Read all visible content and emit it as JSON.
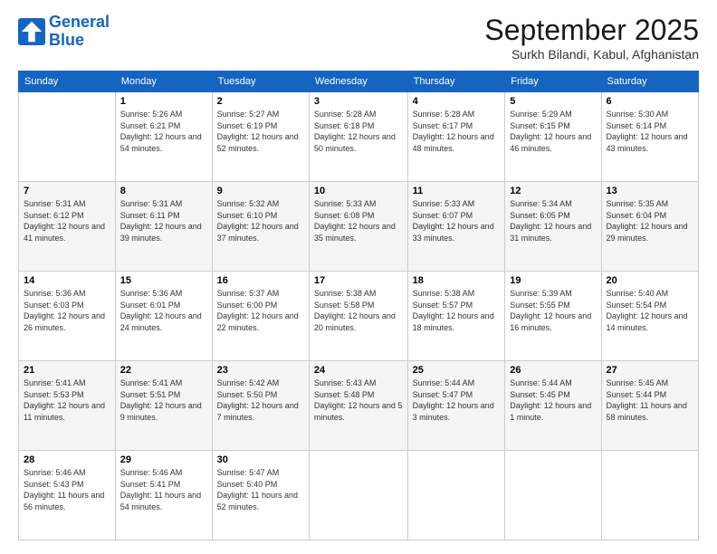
{
  "logo": {
    "line1": "General",
    "line2": "Blue"
  },
  "header": {
    "month": "September 2025",
    "location": "Surkh Bilandi, Kabul, Afghanistan"
  },
  "weekdays": [
    "Sunday",
    "Monday",
    "Tuesday",
    "Wednesday",
    "Thursday",
    "Friday",
    "Saturday"
  ],
  "weeks": [
    [
      {
        "day": "",
        "info": ""
      },
      {
        "day": "1",
        "info": "Sunrise: 5:26 AM\nSunset: 6:21 PM\nDaylight: 12 hours\nand 54 minutes."
      },
      {
        "day": "2",
        "info": "Sunrise: 5:27 AM\nSunset: 6:19 PM\nDaylight: 12 hours\nand 52 minutes."
      },
      {
        "day": "3",
        "info": "Sunrise: 5:28 AM\nSunset: 6:18 PM\nDaylight: 12 hours\nand 50 minutes."
      },
      {
        "day": "4",
        "info": "Sunrise: 5:28 AM\nSunset: 6:17 PM\nDaylight: 12 hours\nand 48 minutes."
      },
      {
        "day": "5",
        "info": "Sunrise: 5:29 AM\nSunset: 6:15 PM\nDaylight: 12 hours\nand 46 minutes."
      },
      {
        "day": "6",
        "info": "Sunrise: 5:30 AM\nSunset: 6:14 PM\nDaylight: 12 hours\nand 43 minutes."
      }
    ],
    [
      {
        "day": "7",
        "info": "Sunrise: 5:31 AM\nSunset: 6:12 PM\nDaylight: 12 hours\nand 41 minutes."
      },
      {
        "day": "8",
        "info": "Sunrise: 5:31 AM\nSunset: 6:11 PM\nDaylight: 12 hours\nand 39 minutes."
      },
      {
        "day": "9",
        "info": "Sunrise: 5:32 AM\nSunset: 6:10 PM\nDaylight: 12 hours\nand 37 minutes."
      },
      {
        "day": "10",
        "info": "Sunrise: 5:33 AM\nSunset: 6:08 PM\nDaylight: 12 hours\nand 35 minutes."
      },
      {
        "day": "11",
        "info": "Sunrise: 5:33 AM\nSunset: 6:07 PM\nDaylight: 12 hours\nand 33 minutes."
      },
      {
        "day": "12",
        "info": "Sunrise: 5:34 AM\nSunset: 6:05 PM\nDaylight: 12 hours\nand 31 minutes."
      },
      {
        "day": "13",
        "info": "Sunrise: 5:35 AM\nSunset: 6:04 PM\nDaylight: 12 hours\nand 29 minutes."
      }
    ],
    [
      {
        "day": "14",
        "info": "Sunrise: 5:36 AM\nSunset: 6:03 PM\nDaylight: 12 hours\nand 26 minutes."
      },
      {
        "day": "15",
        "info": "Sunrise: 5:36 AM\nSunset: 6:01 PM\nDaylight: 12 hours\nand 24 minutes."
      },
      {
        "day": "16",
        "info": "Sunrise: 5:37 AM\nSunset: 6:00 PM\nDaylight: 12 hours\nand 22 minutes."
      },
      {
        "day": "17",
        "info": "Sunrise: 5:38 AM\nSunset: 5:58 PM\nDaylight: 12 hours\nand 20 minutes."
      },
      {
        "day": "18",
        "info": "Sunrise: 5:38 AM\nSunset: 5:57 PM\nDaylight: 12 hours\nand 18 minutes."
      },
      {
        "day": "19",
        "info": "Sunrise: 5:39 AM\nSunset: 5:55 PM\nDaylight: 12 hours\nand 16 minutes."
      },
      {
        "day": "20",
        "info": "Sunrise: 5:40 AM\nSunset: 5:54 PM\nDaylight: 12 hours\nand 14 minutes."
      }
    ],
    [
      {
        "day": "21",
        "info": "Sunrise: 5:41 AM\nSunset: 5:53 PM\nDaylight: 12 hours\nand 11 minutes."
      },
      {
        "day": "22",
        "info": "Sunrise: 5:41 AM\nSunset: 5:51 PM\nDaylight: 12 hours\nand 9 minutes."
      },
      {
        "day": "23",
        "info": "Sunrise: 5:42 AM\nSunset: 5:50 PM\nDaylight: 12 hours\nand 7 minutes."
      },
      {
        "day": "24",
        "info": "Sunrise: 5:43 AM\nSunset: 5:48 PM\nDaylight: 12 hours\nand 5 minutes."
      },
      {
        "day": "25",
        "info": "Sunrise: 5:44 AM\nSunset: 5:47 PM\nDaylight: 12 hours\nand 3 minutes."
      },
      {
        "day": "26",
        "info": "Sunrise: 5:44 AM\nSunset: 5:45 PM\nDaylight: 12 hours\nand 1 minute."
      },
      {
        "day": "27",
        "info": "Sunrise: 5:45 AM\nSunset: 5:44 PM\nDaylight: 11 hours\nand 58 minutes."
      }
    ],
    [
      {
        "day": "28",
        "info": "Sunrise: 5:46 AM\nSunset: 5:43 PM\nDaylight: 11 hours\nand 56 minutes."
      },
      {
        "day": "29",
        "info": "Sunrise: 5:46 AM\nSunset: 5:41 PM\nDaylight: 11 hours\nand 54 minutes."
      },
      {
        "day": "30",
        "info": "Sunrise: 5:47 AM\nSunset: 5:40 PM\nDaylight: 11 hours\nand 52 minutes."
      },
      {
        "day": "",
        "info": ""
      },
      {
        "day": "",
        "info": ""
      },
      {
        "day": "",
        "info": ""
      },
      {
        "day": "",
        "info": ""
      }
    ]
  ]
}
